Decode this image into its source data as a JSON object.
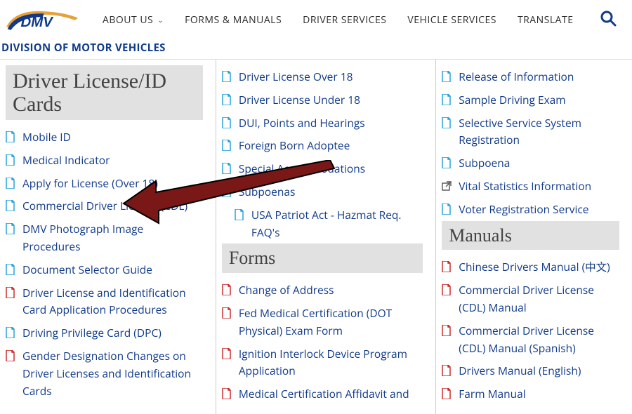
{
  "logo_text": "DMV",
  "nav": [
    "ABOUT US",
    "FORMS & MANUALS",
    "DRIVER SERVICES",
    "VEHICLE SERVICES",
    "TRANSLATE"
  ],
  "subhead": "DIVISION OF MOTOR VEHICLES",
  "col1": {
    "heading": "Driver License/ID Cards",
    "items": [
      {
        "label": "Mobile ID",
        "type": "doc"
      },
      {
        "label": "Medical Indicator",
        "type": "doc"
      },
      {
        "label": "Apply for License (Over 18)",
        "type": "doc"
      },
      {
        "label": "Commercial Driver License (CDL)",
        "type": "doc"
      },
      {
        "label": "DMV Photograph Image Procedures",
        "type": "doc"
      },
      {
        "label": "Document Selector Guide",
        "type": "doc"
      },
      {
        "label": "Driver License and Identification Card Application Procedures",
        "type": "pdf"
      },
      {
        "label": "Driving Privilege Card (DPC)",
        "type": "doc"
      },
      {
        "label": "Gender Designation Changes on Driver Licenses and Identification Cards",
        "type": "pdf"
      }
    ]
  },
  "col2a": {
    "items": [
      {
        "label": "Driver License Over 18",
        "type": "doc"
      },
      {
        "label": "Driver License Under 18",
        "type": "doc"
      },
      {
        "label": "DUI, Points and Hearings",
        "type": "doc"
      },
      {
        "label": "Foreign Born Adoptee",
        "type": "doc"
      },
      {
        "label": "Special Accommodations",
        "type": "doc"
      },
      {
        "label": "Subpoenas",
        "type": "doc"
      },
      {
        "label": "USA Patriot Act - Hazmat Req. FAQ's",
        "type": "doc",
        "indent": true
      }
    ]
  },
  "col2b": {
    "heading": "Forms",
    "items": [
      {
        "label": "Change of Address",
        "type": "pdf"
      },
      {
        "label": "Fed Medical Certification (DOT Physical) Exam Form",
        "type": "pdf"
      },
      {
        "label": "Ignition Interlock Device Program Application",
        "type": "pdf"
      },
      {
        "label": "Medical Certification Affidavit and",
        "type": "pdf"
      }
    ]
  },
  "col3a": {
    "items": [
      {
        "label": "Release of Information",
        "type": "doc"
      },
      {
        "label": "Sample Driving Exam",
        "type": "doc"
      },
      {
        "label": "Selective Service System Registration",
        "type": "doc"
      },
      {
        "label": "Subpoena",
        "type": "doc"
      },
      {
        "label": "Vital Statistics Information",
        "type": "ext"
      },
      {
        "label": "Voter Registration Service",
        "type": "doc"
      }
    ]
  },
  "col3b": {
    "heading": "Manuals",
    "items": [
      {
        "label": "Chinese Drivers Manual (中文)",
        "type": "pdf"
      },
      {
        "label": "Commercial Driver License (CDL) Manual",
        "type": "pdf"
      },
      {
        "label": "Commercial Driver License (CDL) Manual (Spanish)",
        "type": "pdf"
      },
      {
        "label": "Drivers Manual (English)",
        "type": "pdf"
      },
      {
        "label": "Farm Manual",
        "type": "pdf"
      }
    ]
  }
}
